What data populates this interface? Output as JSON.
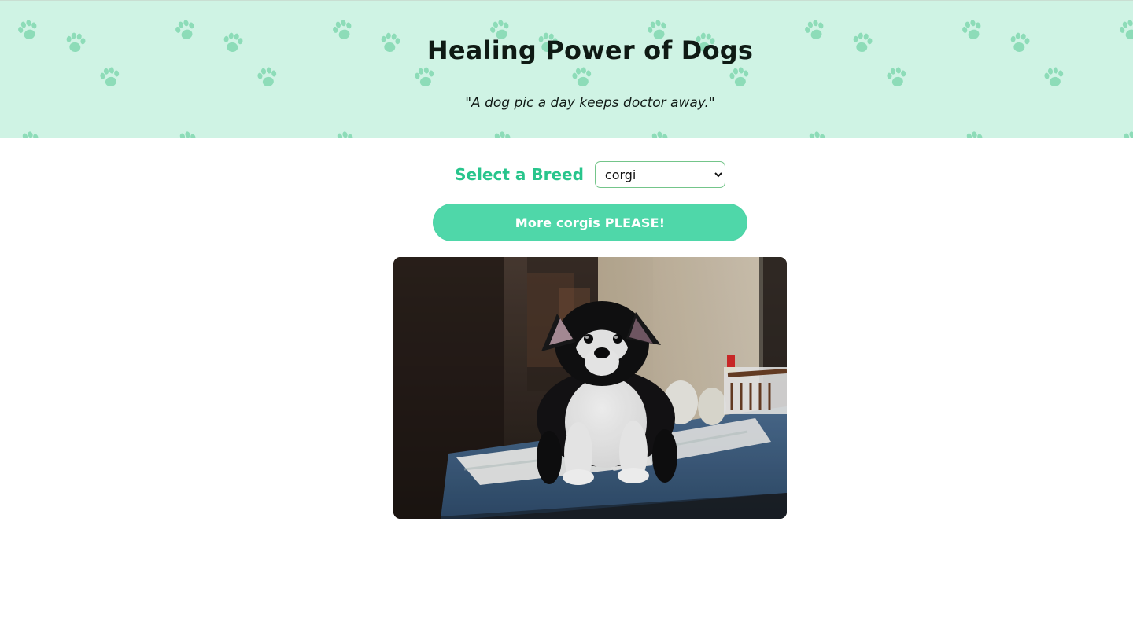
{
  "header": {
    "title": "Healing Power of Dogs",
    "subtitle": "\"A dog pic a day keeps doctor away.\"",
    "background_color": "#cff3e4",
    "paw_icon": "paw-print-icon"
  },
  "breed_selector": {
    "label": "Select a Breed",
    "selected_value": "corgi"
  },
  "more_button": {
    "label": "More corgis PLEASE!"
  },
  "dog_image": {
    "icon": "corgi-puppy-photo",
    "subject": "corgi puppy standing on a blue table"
  },
  "colors": {
    "accent_green": "#28c58c",
    "button_green": "#4fd7a9"
  }
}
